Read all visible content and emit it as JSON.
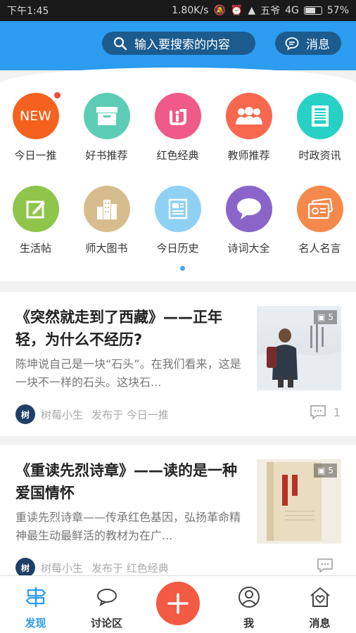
{
  "status_bar": {
    "time": "下午1:45",
    "speed": "1.80K/s",
    "carrier": "五爷",
    "network": "4G",
    "battery": "57%",
    "battery_level": 0.57
  },
  "header": {
    "search_placeholder": "输入要搜索的内容",
    "message_label": "消息",
    "accent_color": "#2b9cf0"
  },
  "categories": [
    {
      "label": "今日一推",
      "icon": "new-icon",
      "color": "#f4621e",
      "badge": true,
      "badge_text": "NEW"
    },
    {
      "label": "好书推荐",
      "icon": "archive-box-icon",
      "color": "#5ccdb4"
    },
    {
      "label": "红色经典",
      "icon": "red-classic-icon",
      "color": "#f05a86"
    },
    {
      "label": "教师推荐",
      "icon": "people-group-icon",
      "color": "#f7684e"
    },
    {
      "label": "时政资讯",
      "icon": "news-paper-icon",
      "color": "#28d1c6"
    },
    {
      "label": "生活帖",
      "icon": "edit-note-icon",
      "color": "#8ec54a"
    },
    {
      "label": "师大图书",
      "icon": "buildings-icon",
      "color": "#d7bd8e"
    },
    {
      "label": "今日历史",
      "icon": "calendar-page-icon",
      "color": "#8fd1f5"
    },
    {
      "label": "诗词大全",
      "icon": "speech-bubble-icon",
      "color": "#8a64c9"
    },
    {
      "label": "名人名言",
      "icon": "ticket-card-icon",
      "color": "#f5894c"
    }
  ],
  "articles": [
    {
      "title": "《突然就走到了西藏》——正年轻，为什么不经历?",
      "desc": "陈坤说自己是一块“石头”。在我们看来，这是一块不一样的石头。这块石...",
      "author": "树莓小生",
      "published_in": "发布于 今日一推",
      "photo_count": "5",
      "comment_count": "1",
      "avatar_text": "树"
    },
    {
      "title": "《重读先烈诗章》——读的是一种爱国情怀",
      "desc": "重读先烈诗章——传承红色基因，弘扬革命精神最生动最鲜活的教材为在广...",
      "author": "树莓小生",
      "published_in": "发布于 红色经典",
      "photo_count": "5",
      "comment_count": "",
      "avatar_text": "树"
    }
  ],
  "bottom_nav": {
    "discover": "发现",
    "discussion": "讨论区",
    "me": "我",
    "messages": "消息"
  }
}
